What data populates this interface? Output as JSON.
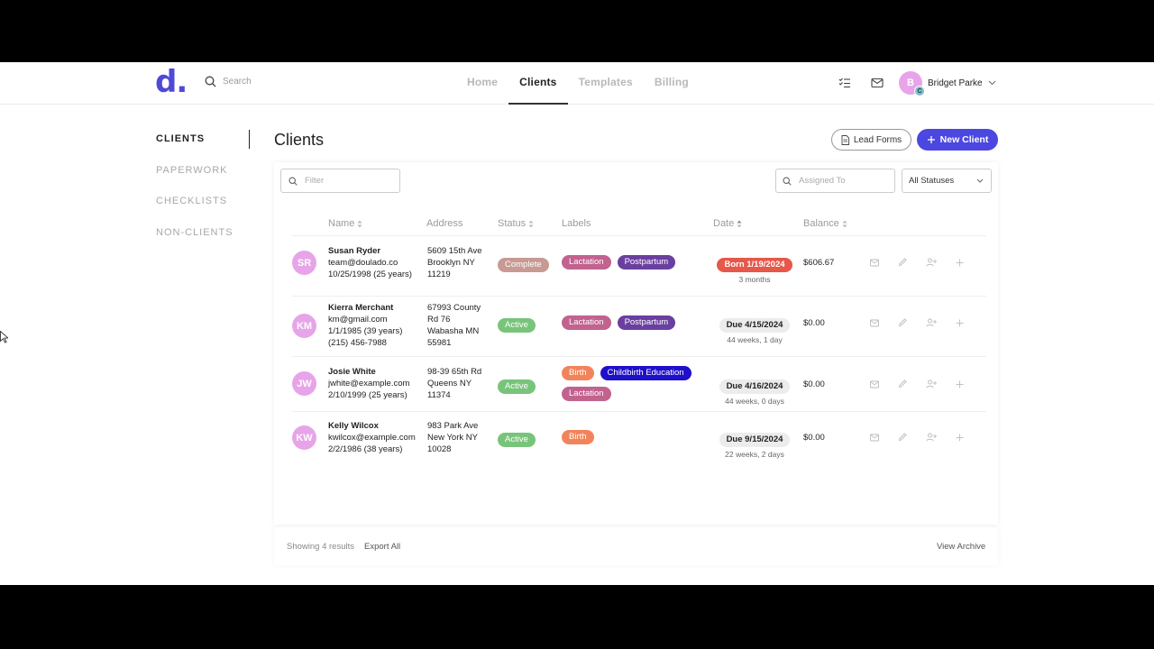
{
  "app": {
    "logo_text": "d.",
    "brand_color": "#4b47e0",
    "search_placeholder": "Search",
    "nav": [
      {
        "label": "Home",
        "active": false
      },
      {
        "label": "Clients",
        "active": true
      },
      {
        "label": "Templates",
        "active": false
      },
      {
        "label": "Billing",
        "active": false
      }
    ],
    "user": {
      "name": "Bridget Parke",
      "initial": "B",
      "badge_initial": "C"
    }
  },
  "sidebar": {
    "items": [
      {
        "label": "CLIENTS",
        "active": true
      },
      {
        "label": "PAPERWORK",
        "active": false
      },
      {
        "label": "CHECKLISTS",
        "active": false
      },
      {
        "label": "NON-CLIENTS",
        "active": false
      }
    ]
  },
  "main": {
    "title": "Clients",
    "lead_forms_label": "Lead Forms",
    "new_client_label": "New Client",
    "filter_placeholder": "Filter",
    "assigned_placeholder": "Assigned To",
    "status_filter_value": "All Statuses"
  },
  "table": {
    "headers": {
      "name": "Name",
      "address": "Address",
      "status": "Status",
      "labels": "Labels",
      "date": "Date",
      "balance": "Balance"
    },
    "rows": [
      {
        "initials": "SR",
        "name": "Susan Ryder",
        "email": "team@doulado.co",
        "dob": "10/25/1998 (25 years)",
        "phone": "",
        "address": [
          "5609 15th Ave",
          "Brooklyn NY",
          "11219"
        ],
        "status": "Complete",
        "status_color": "#c79a93",
        "labels": [
          {
            "text": "Lactation",
            "color": "#c2628f"
          },
          {
            "text": "Postpartum",
            "color": "#6b3fa0"
          }
        ],
        "date_label": "Born 1/19/2024",
        "date_sub": "3 months",
        "date_born": true,
        "balance": "$606.67"
      },
      {
        "initials": "KM",
        "name": "Kierra Merchant",
        "email": "km@gmail.com",
        "dob": "1/1/1985 (39 years)",
        "phone": "(215) 456-7988",
        "address": [
          "67993 County",
          "Rd 76",
          "Wabasha MN",
          "55981"
        ],
        "status": "Active",
        "status_color": "#79c47b",
        "labels": [
          {
            "text": "Lactation",
            "color": "#c2628f"
          },
          {
            "text": "Postpartum",
            "color": "#6b3fa0"
          }
        ],
        "date_label": "Due 4/15/2024",
        "date_sub": "44 weeks, 1 day",
        "date_born": false,
        "balance": "$0.00"
      },
      {
        "initials": "JW",
        "name": "Josie White",
        "email": "jwhite@example.com",
        "dob": "2/10/1999 (25 years)",
        "phone": "",
        "address": [
          "98-39 65th Rd",
          "Queens NY",
          "11374"
        ],
        "status": "Active",
        "status_color": "#79c47b",
        "labels": [
          {
            "text": "Birth",
            "color": "#f2845c"
          },
          {
            "text": "Childbirth Education",
            "color": "#1f10c9"
          },
          {
            "text": "Lactation",
            "color": "#c2628f"
          }
        ],
        "date_label": "Due 4/16/2024",
        "date_sub": "44 weeks, 0 days",
        "date_born": false,
        "balance": "$0.00"
      },
      {
        "initials": "KW",
        "name": "Kelly Wilcox",
        "email": "kwilcox@example.com",
        "dob": "2/2/1986 (38 years)",
        "phone": "",
        "address": [
          "983 Park Ave",
          "New York NY",
          "10028"
        ],
        "status": "Active",
        "status_color": "#79c47b",
        "labels": [
          {
            "text": "Birth",
            "color": "#f2845c"
          }
        ],
        "date_label": "Due 9/15/2024",
        "date_sub": "22 weeks, 2 days",
        "date_born": false,
        "balance": "$0.00"
      }
    ],
    "row_icons": [
      "mail-icon",
      "pencil-icon",
      "add-user-icon",
      "plus-icon"
    ]
  },
  "footer": {
    "showing": "Showing 4 results",
    "export": "Export All",
    "archive": "View Archive"
  }
}
